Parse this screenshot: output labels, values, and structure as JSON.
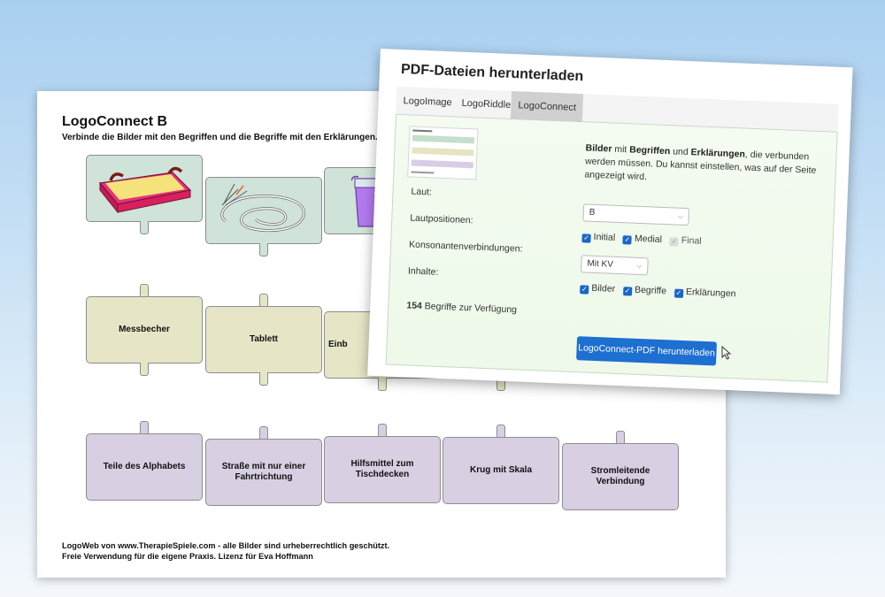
{
  "worksheet": {
    "title": "LogoConnect B",
    "subtitle": "Verbinde die Bilder mit den Begriffen und die Begriffe mit den Erklärungen.",
    "words": [
      "Messbecher",
      "Tablett",
      "Einb"
    ],
    "definitions": [
      "Teile des Alphabets",
      "Straße mit nur einer Fahrtrichtung",
      "Hilfsmittel zum  Tischdecken",
      "Krug mit Skala",
      "Stromleitende Verbindung"
    ],
    "footer_line1": "LogoWeb von www.TherapieSpiele.com - alle Bilder sind urheberrechtlich geschützt.",
    "footer_line2": "Freie Verwendung für die eigene Praxis. Lizenz für Eva Hoffmann"
  },
  "dialog": {
    "title": "PDF-Dateien herunterladen",
    "tabs": [
      "LogoImage",
      "LogoRiddle",
      "LogoConnect"
    ],
    "active_tab": "LogoConnect",
    "info": {
      "t1": "Bilder",
      "t2": " mit ",
      "t3": "Begriffen",
      "t4": " und ",
      "t5": "Erklärungen",
      "t6": ", die verbunden werden müssen. Du kannst einstellen, was auf der Seite angezeigt wird."
    },
    "laut": {
      "label": "Laut:",
      "value": "B"
    },
    "positions": {
      "label": "Lautpositionen:",
      "initial": "Initial",
      "medial": "Medial",
      "final": "Final"
    },
    "consonants": {
      "label": "Konsonantenverbindungen:",
      "value": "Mit KV"
    },
    "contents": {
      "label": "Inhalte:",
      "bilder": "Bilder",
      "begriffe": "Begriffe",
      "erklaerungen": "Erklärungen"
    },
    "count_number": "154",
    "count_text": "Begriffe zur Verfügung",
    "download_button": "LogoConnect-PDF herunterladen"
  },
  "colors": {
    "accent": "#1d6fd1",
    "picture_card": "#cfe3d8",
    "word_card": "#e6e6c7",
    "definition_card": "#d8cfe2"
  },
  "icons": [
    "checkbox-checked-icon",
    "chevron-down-icon",
    "mouse-pointer-icon"
  ]
}
